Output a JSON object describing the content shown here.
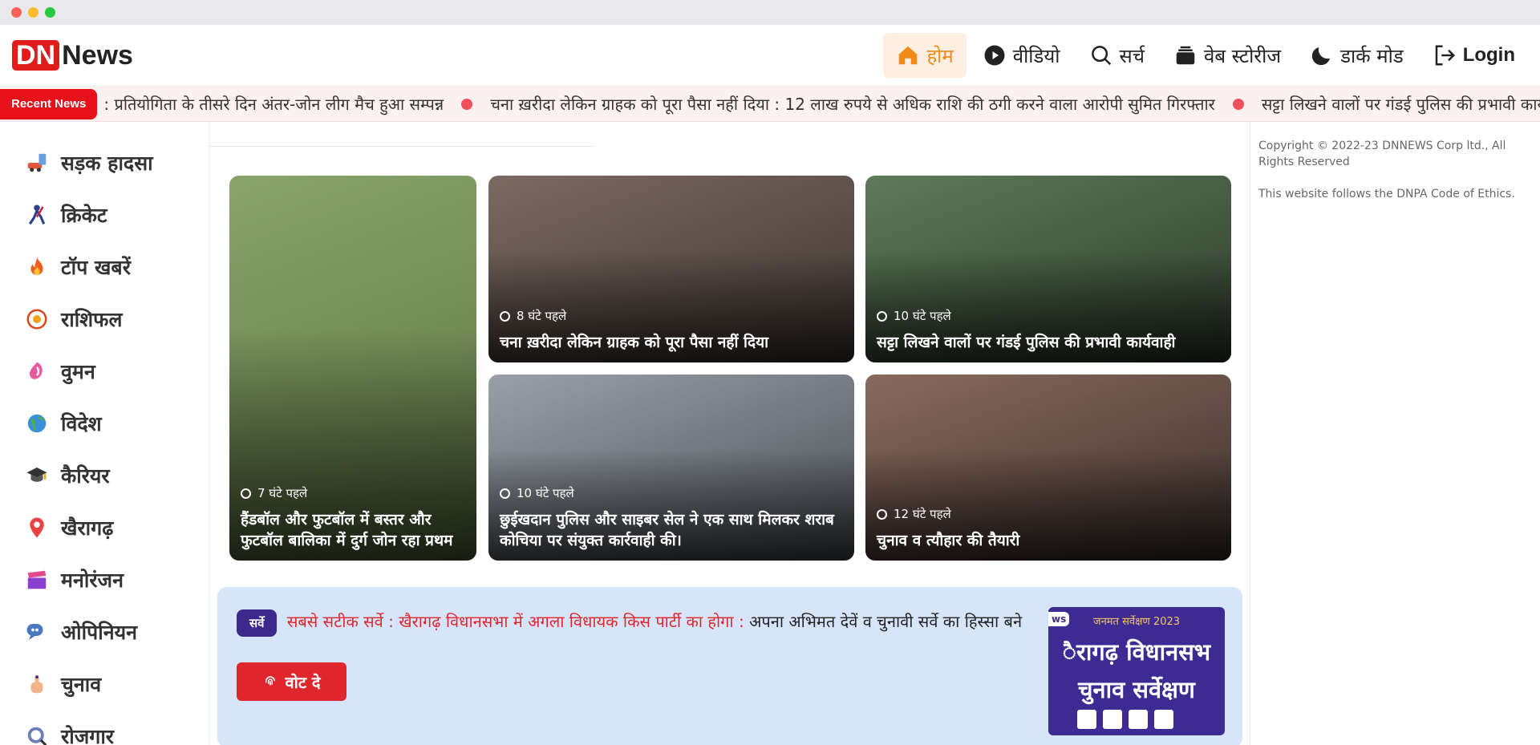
{
  "logo": {
    "dn": "DN",
    "news": "News"
  },
  "nav": [
    {
      "label": "होम",
      "icon": "home-icon",
      "active": true
    },
    {
      "label": "वीडियो",
      "icon": "play-icon"
    },
    {
      "label": "सर्च",
      "icon": "search-icon"
    },
    {
      "label": "वेब स्टोरीज",
      "icon": "stories-icon"
    },
    {
      "label": "डार्क मोड",
      "icon": "moon-icon"
    },
    {
      "label": "Login",
      "icon": "login-icon"
    }
  ],
  "ticker": {
    "label": "Recent News",
    "items": [
      ": प्रतियोगिता के तीसरे दिन अंतर-जोन लीग मैच हुआ सम्पन्न",
      "चना ख़रीदा लेकिन ग्राहक को पूरा पैसा नहीं दिया : 12 लाख रुपये से अधिक राशि की ठगी करने वाला आरोपी सुमित गिरफ्तार",
      "सट्टा लिखने वालों पर गंडई पुलिस की प्रभावी कार्यवाही"
    ]
  },
  "sidebar": [
    {
      "label": "सड़क हादसा",
      "icon": "road-accident-icon"
    },
    {
      "label": "क्रिकेट",
      "icon": "cricket-icon"
    },
    {
      "label": "टॉप खबरें",
      "icon": "fire-icon"
    },
    {
      "label": "राशिफल",
      "icon": "sun-icon"
    },
    {
      "label": "वुमन",
      "icon": "woman-icon"
    },
    {
      "label": "विदेश",
      "icon": "globe-icon"
    },
    {
      "label": "कैरियर",
      "icon": "graduation-cap-icon"
    },
    {
      "label": "खैरागढ़",
      "icon": "location-pin-icon"
    },
    {
      "label": "मनोरंजन",
      "icon": "clapperboard-icon"
    },
    {
      "label": "ओपिनियन",
      "icon": "speech-bubble-icon"
    },
    {
      "label": "चुनाव",
      "icon": "vote-finger-icon"
    },
    {
      "label": "रोजगार",
      "icon": "jobs-icon"
    }
  ],
  "cards": [
    {
      "time": "7 घंटे पहले",
      "title": "हैंडबॉल और फुटबॉल में बस्तर और फुटबॉल बालिका में दुर्ग जोन रहा प्रथम",
      "colors": [
        "#8aa36a",
        "#5c7343"
      ]
    },
    {
      "time": "8 घंटे पहले",
      "title": "चना ख़रीदा लेकिन ग्राहक को पूरा पैसा नहीं दिया",
      "colors": [
        "#7a6a63",
        "#3f3530"
      ]
    },
    {
      "time": "10 घंटे पहले",
      "title": "सट्टा लिखने वालों पर गंडई पुलिस की प्रभावी कार्यवाही",
      "colors": [
        "#5e7a5a",
        "#2e3b2b"
      ]
    },
    {
      "time": "10 घंटे पहले",
      "title": "छुईखदान पुलिस और साइबर सेल ने एक साथ मिलकर शराब कोचिया पर संयुक्त कार्रवाही की।",
      "colors": [
        "#9aa0a8",
        "#4a4f55"
      ]
    },
    {
      "time": "12 घंटे पहले",
      "title": "चुनाव व त्यौहार की तैयारी",
      "colors": [
        "#8a6a5f",
        "#3b302c"
      ]
    }
  ],
  "survey": {
    "badge": "सर्वे",
    "headline": "सबसे सटीक सर्वे : खैरागढ़ विधानसभा में अगला विधायक किस पार्टी का होगा :",
    "text": "अपना अभिमत देवें व चुनावी सर्वे का हिस्सा बने",
    "button": "वोट दे",
    "poster": {
      "tag": "ws",
      "sub": "जनमत सर्वेक्षण 2023",
      "line1": "ैरागढ़ विधानसभ",
      "line2": "चुनाव सर्वेक्षण"
    }
  },
  "footer": {
    "copyright": "Copyright © 2022-23 DNNEWS Corp ltd., All Rights Reserved",
    "ethics": "This website follows the DNPA Code of Ethics."
  },
  "colors": {
    "brand": "#e01b1b",
    "accent": "#f28a18",
    "survey_bg": "#d7e5fb",
    "badge": "#3b2a8c"
  }
}
